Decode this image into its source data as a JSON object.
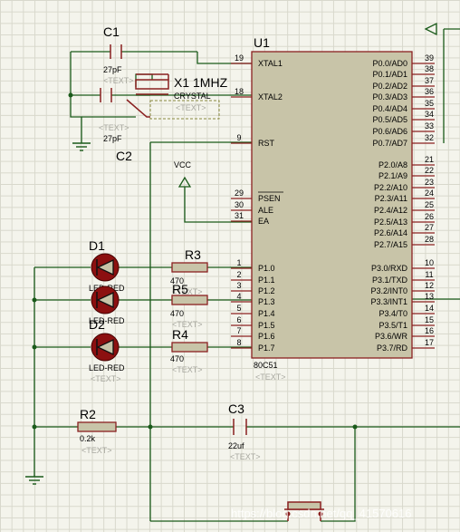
{
  "chip": {
    "name": "U1",
    "part": "80C51",
    "placeholder": "<TEXT>"
  },
  "left_pins": [
    {
      "num": "19",
      "label": "XTAL1"
    },
    {
      "num": "18",
      "label": "XTAL2"
    },
    {
      "num": "9",
      "label": "RST"
    },
    {
      "num": "29",
      "label": "PSEN"
    },
    {
      "num": "30",
      "label": "ALE"
    },
    {
      "num": "31",
      "label": "EA"
    },
    {
      "num": "1",
      "label": "P1.0"
    },
    {
      "num": "2",
      "label": "P1.1"
    },
    {
      "num": "3",
      "label": "P1.2"
    },
    {
      "num": "4",
      "label": "P1.3"
    },
    {
      "num": "5",
      "label": "P1.4"
    },
    {
      "num": "6",
      "label": "P1.5"
    },
    {
      "num": "7",
      "label": "P1.6"
    },
    {
      "num": "8",
      "label": "P1.7"
    }
  ],
  "right_pins": [
    {
      "num": "39",
      "label": "P0.0/AD0"
    },
    {
      "num": "38",
      "label": "P0.1/AD1"
    },
    {
      "num": "37",
      "label": "P0.2/AD2"
    },
    {
      "num": "36",
      "label": "P0.3/AD3"
    },
    {
      "num": "35",
      "label": "P0.4/AD4"
    },
    {
      "num": "34",
      "label": "P0.5/AD5"
    },
    {
      "num": "33",
      "label": "P0.6/AD6"
    },
    {
      "num": "32",
      "label": "P0.7/AD7"
    },
    {
      "num": "21",
      "label": "P2.0/A8"
    },
    {
      "num": "22",
      "label": "P2.1/A9"
    },
    {
      "num": "23",
      "label": "P2.2/A10"
    },
    {
      "num": "24",
      "label": "P2.3/A11"
    },
    {
      "num": "25",
      "label": "P2.4/A12"
    },
    {
      "num": "26",
      "label": "P2.5/A13"
    },
    {
      "num": "27",
      "label": "P2.6/A14"
    },
    {
      "num": "28",
      "label": "P2.7/A15"
    },
    {
      "num": "10",
      "label": "P3.0/RXD"
    },
    {
      "num": "11",
      "label": "P3.1/TXD"
    },
    {
      "num": "12",
      "label": "P3.2/INT0"
    },
    {
      "num": "13",
      "label": "P3.3/INT1"
    },
    {
      "num": "14",
      "label": "P3.4/T0"
    },
    {
      "num": "15",
      "label": "P3.5/T1"
    },
    {
      "num": "16",
      "label": "P3.6/WR"
    },
    {
      "num": "17",
      "label": "P3.7/RD"
    }
  ],
  "c1": {
    "name": "C1",
    "value": "27pF",
    "placeholder": "<TEXT>"
  },
  "c2": {
    "name": "C2",
    "value": "27pF",
    "placeholder": "<TEXT>"
  },
  "c3": {
    "name": "C3",
    "value": "22uf",
    "placeholder": "<TEXT>"
  },
  "x1": {
    "name": "X1 1MHZ",
    "type": "CRYSTAL",
    "placeholder": "<TEXT>"
  },
  "vcc": {
    "label": "VCC"
  },
  "r3": {
    "name": "R3",
    "value": "470",
    "placeholder": "<TEXT>"
  },
  "r5": {
    "name": "R5",
    "value": "470",
    "placeholder": "<TEXT>"
  },
  "r4": {
    "name": "R4",
    "value": "470",
    "placeholder": "<TEXT>"
  },
  "r2": {
    "name": "R2",
    "value": "0.2k",
    "placeholder": "<TEXT>"
  },
  "d1": {
    "name": "D1",
    "type": "LED-RED"
  },
  "d3": {
    "type": "LED-RED"
  },
  "d2": {
    "name": "D2",
    "type": "LED-RED",
    "placeholder": "<TEXT>"
  },
  "watermark": "https://blog.csdn.net/qq_41570616"
}
